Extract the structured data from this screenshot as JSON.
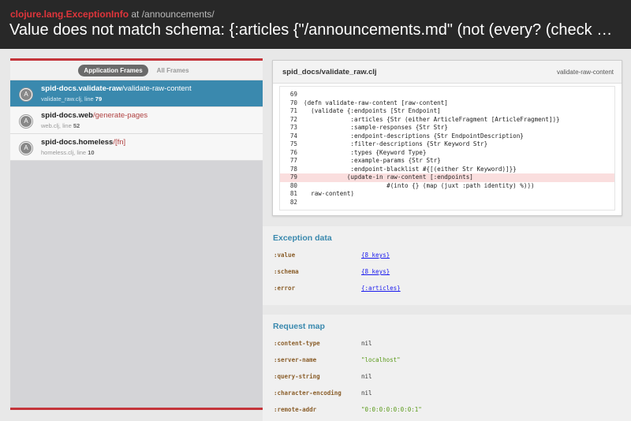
{
  "header": {
    "exception_class": "clojure.lang.ExceptionInfo",
    "at_text": " at /announcements/",
    "message": "Value does not match schema: {:articles {\"/announcements.md\" (not (every? (check % a-clojure.lang.PersistentArrayMap)))}}"
  },
  "tabs": [
    "Application Frames",
    "All Frames"
  ],
  "frames": [
    {
      "badge": "A",
      "ns": "spid-docs.validate-raw",
      "fn": "/validate-raw-content",
      "file": "validate_raw.clj, line ",
      "line": "79"
    },
    {
      "badge": "A",
      "ns": "spid-docs.web",
      "fn": "/generate-pages",
      "file": "web.clj, line ",
      "line": "52"
    },
    {
      "badge": "A",
      "ns": "spid-docs.homeless",
      "fn": "/[fn]",
      "file": "homeless.clj, line ",
      "line": "10"
    }
  ],
  "code": {
    "file": "spid_docs/validate_raw.clj",
    "fn_name": "validate-raw-content",
    "lines": [
      {
        "no": "69",
        "text": ""
      },
      {
        "no": "70",
        "text": "(defn validate-raw-content [raw-content]"
      },
      {
        "no": "71",
        "text": "  (validate {:endpoints [Str Endpoint]"
      },
      {
        "no": "72",
        "text": "             :articles {Str (either ArticleFragment [ArticleFragment])}"
      },
      {
        "no": "73",
        "text": "             :sample-responses {Str Str}"
      },
      {
        "no": "74",
        "text": "             :endpoint-descriptions {Str EndpointDescription}"
      },
      {
        "no": "75",
        "text": "             :filter-descriptions {Str Keyword Str}"
      },
      {
        "no": "76",
        "text": "             :types {Keyword Type}"
      },
      {
        "no": "77",
        "text": "             :example-params {Str Str}"
      },
      {
        "no": "78",
        "text": "             :endpoint-blacklist #{[(either Str Keyword)]}}"
      },
      {
        "no": "79",
        "text": "            (update-in raw-content [:endpoints]"
      },
      {
        "no": "80",
        "text": "                       #(into {} (map (juxt :path identity) %)))"
      },
      {
        "no": "81",
        "text": "  raw-content)"
      },
      {
        "no": "82",
        "text": ""
      }
    ],
    "highlight": "79"
  },
  "exception_data": {
    "title": "Exception data",
    "rows": [
      {
        "key": ":value",
        "val": "{8 keys}",
        "kind": "link"
      },
      {
        "key": ":schema",
        "val": "{8 keys}",
        "kind": "link"
      },
      {
        "key": ":error",
        "val": "{:articles}",
        "kind": "link"
      }
    ]
  },
  "request_map": {
    "title": "Request map",
    "rows": [
      {
        "key": ":content-type",
        "val": "nil",
        "kind": "plain"
      },
      {
        "key": ":server-name",
        "val": "\"localhost\"",
        "kind": "str"
      },
      {
        "key": ":query-string",
        "val": "nil",
        "kind": "plain"
      },
      {
        "key": ":character-encoding",
        "val": "nil",
        "kind": "plain"
      },
      {
        "key": ":remote-addr",
        "val": "\"0:0:0:0:0:0:0:1\"",
        "kind": "str"
      }
    ]
  },
  "colors": {
    "accent": "#3a89ae",
    "error": "#e0353b",
    "header_bg": "#282828"
  }
}
